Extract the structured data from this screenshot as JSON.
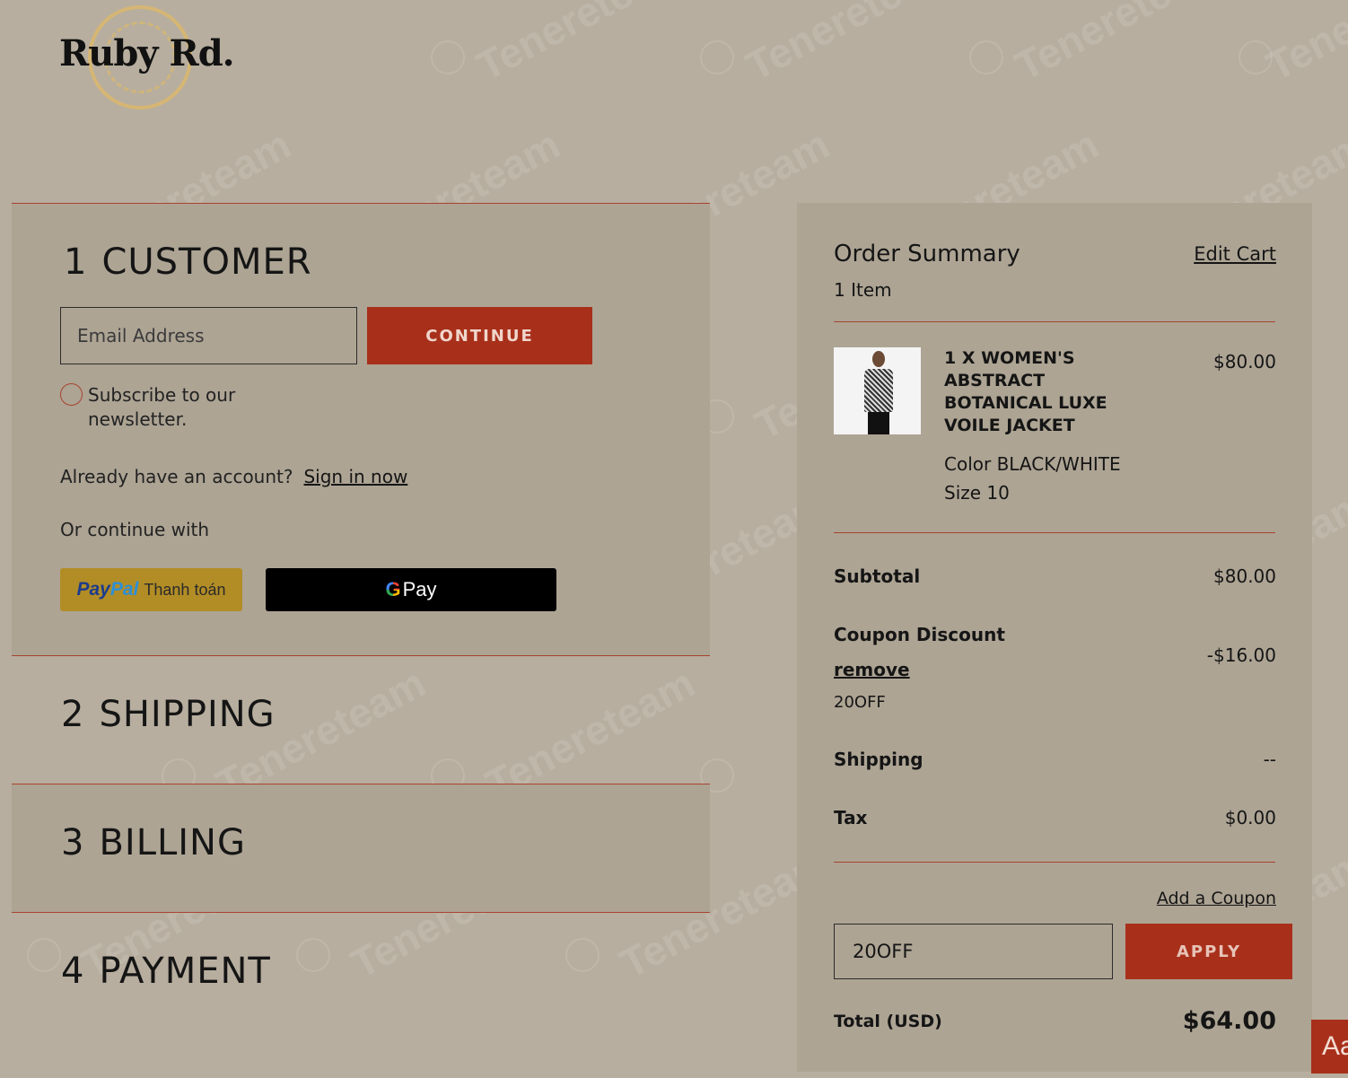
{
  "brand": {
    "logo_text": "Ruby Rd."
  },
  "watermark": {
    "text": "Tenereteam"
  },
  "steps": {
    "customer": {
      "number": "1",
      "title": "CUSTOMER",
      "email_placeholder": "Email Address",
      "continue_label": "CONTINUE",
      "subscribe_label": "Subscribe to our newsletter.",
      "account_prompt": "Already have an account?",
      "sign_in_label": "Sign in now",
      "or_continue_label": "Or continue with",
      "paypal_brand_1": "Pay",
      "paypal_brand_2": "Pal",
      "paypal_label": "Thanh toán",
      "gpay_g": "G",
      "gpay_label": "Pay"
    },
    "shipping": {
      "number": "2",
      "title": "SHIPPING"
    },
    "billing": {
      "number": "3",
      "title": "BILLING"
    },
    "payment": {
      "number": "4",
      "title": "PAYMENT"
    }
  },
  "summary": {
    "title": "Order Summary",
    "edit_cart_label": "Edit Cart",
    "item_count": "1 Item",
    "item": {
      "name": "1 X WOMEN'S ABSTRACT BOTANICAL LUXE VOILE JACKET",
      "price": "$80.00",
      "color": "Color BLACK/WHITE",
      "size": "Size 10"
    },
    "subtotal_label": "Subtotal",
    "subtotal_value": "$80.00",
    "coupon_label": "Coupon Discount",
    "coupon_remove_label": "remove",
    "coupon_code": "20OFF",
    "coupon_value": "-$16.00",
    "shipping_label": "Shipping",
    "shipping_value": "--",
    "tax_label": "Tax",
    "tax_value": "$0.00",
    "add_coupon_label": "Add a Coupon",
    "coupon_input_value": "20OFF",
    "apply_label": "APPLY",
    "total_label": "Total (USD)",
    "total_value": "$64.00"
  },
  "accessibility": {
    "label": "Aa"
  },
  "colors": {
    "background": "#b7ae9f",
    "panel": "#ada494",
    "accent": "#a8301b",
    "divider": "#a8432e"
  }
}
